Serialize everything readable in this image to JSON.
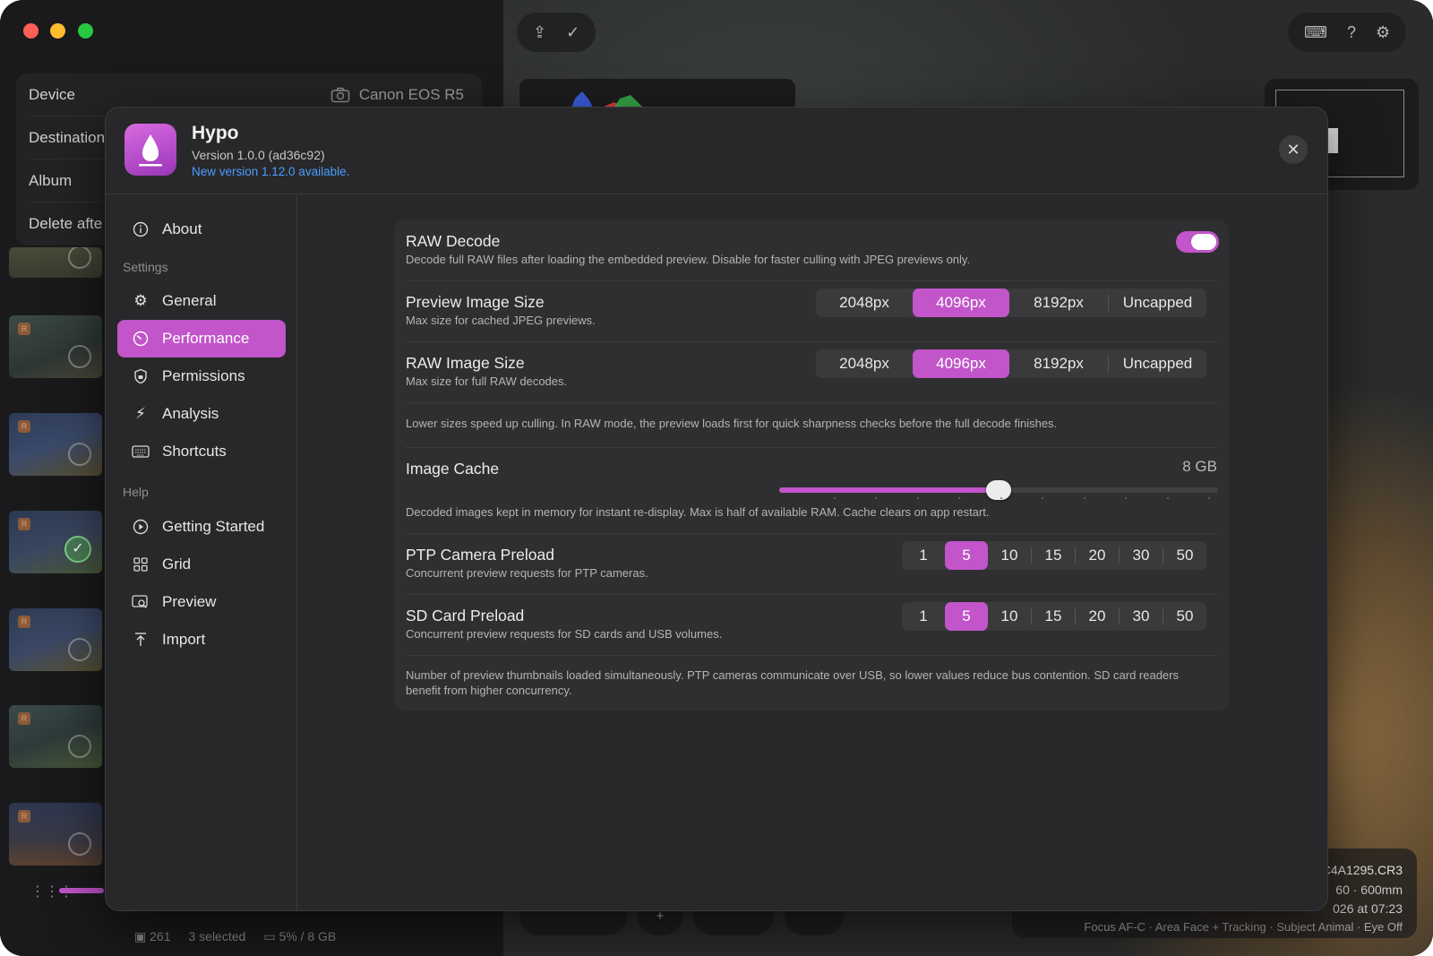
{
  "import": {
    "rows": [
      {
        "label": "Device",
        "value": "Canon EOS R5",
        "icon": "camera-icon"
      },
      {
        "label": "Destination",
        "value": ""
      },
      {
        "label": "Album",
        "value": ""
      },
      {
        "label": "Delete afte",
        "value": ""
      }
    ]
  },
  "status": {
    "count": "261",
    "selected": "3 selected",
    "storage": "5% / 8 GB"
  },
  "photo": {
    "filename": "C4A1295.CR3",
    "lens": "60  ·  600mm",
    "date": "026 at 07:23",
    "meta": "Focus AF-C  ·  Area Face + Tracking  ·  Subject Animal  ·  Eye Off"
  },
  "about": {
    "app_name": "Hypo",
    "version": "Version 1.0.0 (ad36c92)",
    "update": "New version 1.12.0 available.",
    "close_icon": "close-icon"
  },
  "sidebar": {
    "about": "About",
    "settings_header": "Settings",
    "help_header": "Help",
    "settings_items": [
      {
        "label": "General",
        "icon": "gear-icon"
      },
      {
        "label": "Performance",
        "icon": "gauge-icon"
      },
      {
        "label": "Permissions",
        "icon": "lock-shield-icon"
      },
      {
        "label": "Analysis",
        "icon": "sparkles-icon"
      },
      {
        "label": "Shortcuts",
        "icon": "keyboard-icon"
      }
    ],
    "help_items": [
      {
        "label": "Getting Started",
        "icon": "play-icon"
      },
      {
        "label": "Grid",
        "icon": "grid-icon"
      },
      {
        "label": "Preview",
        "icon": "preview-icon"
      },
      {
        "label": "Import",
        "icon": "import-icon"
      }
    ],
    "active": "Performance"
  },
  "performance": {
    "raw_decode": {
      "title": "RAW Decode",
      "desc": "Decode full RAW files after loading the embedded preview. Disable for faster culling with JPEG previews only.",
      "enabled": true
    },
    "preview_size": {
      "title": "Preview Image Size",
      "desc": "Max size for cached JPEG previews.",
      "options": [
        "2048px",
        "4096px",
        "8192px",
        "Uncapped"
      ],
      "selected": "4096px"
    },
    "raw_size": {
      "title": "RAW Image Size",
      "desc": "Max size for full RAW decodes.",
      "options": [
        "2048px",
        "4096px",
        "8192px",
        "Uncapped"
      ],
      "selected": "4096px"
    },
    "size_note": "Lower sizes speed up culling. In RAW mode, the preview loads first for quick sharpness checks before the full decode finishes.",
    "image_cache": {
      "title": "Image Cache",
      "value": "8 GB",
      "fraction": 0.5,
      "desc": "Decoded images kept in memory for instant re-display. Max is half of available RAM. Cache clears on app restart."
    },
    "ptp_preload": {
      "title": "PTP Camera Preload",
      "desc": "Concurrent preview requests for PTP cameras.",
      "options": [
        "1",
        "5",
        "10",
        "15",
        "20",
        "30",
        "50"
      ],
      "selected": "5"
    },
    "sd_preload": {
      "title": "SD Card Preload",
      "desc": "Concurrent preview requests for SD cards and USB volumes.",
      "options": [
        "1",
        "5",
        "10",
        "15",
        "20",
        "30",
        "50"
      ],
      "selected": "5"
    },
    "preload_note": "Number of preview thumbnails loaded simultaneously. PTP cameras communicate over USB, so lower values reduce bus contention. SD card readers benefit from higher concurrency."
  },
  "colors": {
    "accent": "#c155c9",
    "link": "#4a9dff"
  }
}
